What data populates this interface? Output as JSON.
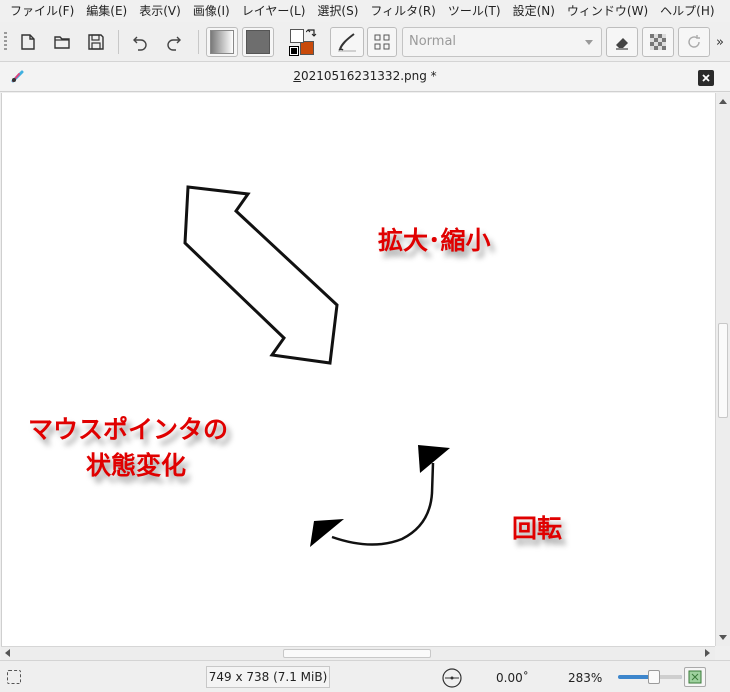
{
  "menu": {
    "items": [
      {
        "label": "ファイル(F)"
      },
      {
        "label": "編集(E)"
      },
      {
        "label": "表示(V)"
      },
      {
        "label": "画像(I)"
      },
      {
        "label": "レイヤー(L)"
      },
      {
        "label": "選択(S)"
      },
      {
        "label": "フィルタ(R)"
      },
      {
        "label": "ツール(T)"
      },
      {
        "label": "設定(N)"
      },
      {
        "label": "ウィンドウ(W)"
      },
      {
        "label": "ヘルプ(H)"
      }
    ]
  },
  "toolbar": {
    "blend_mode": "Normal",
    "overflow_label": "»",
    "foreground_color": "#ffffff",
    "background_color": "#c94a0a"
  },
  "document": {
    "tab_title_mnemonic": "2",
    "tab_title_rest": "0210516231332.png *"
  },
  "canvas": {
    "label_scale": "拡大･縮小",
    "label_pointer_line1": "マウスポインタの",
    "label_pointer_line2": "状態変化",
    "label_rotate": "回転",
    "text_color": "#e00000"
  },
  "status": {
    "image_size": "749 x 738 (7.1 MiB)",
    "angle": "0.00˚",
    "zoom": "283%",
    "zoom_level_percent": 56
  }
}
